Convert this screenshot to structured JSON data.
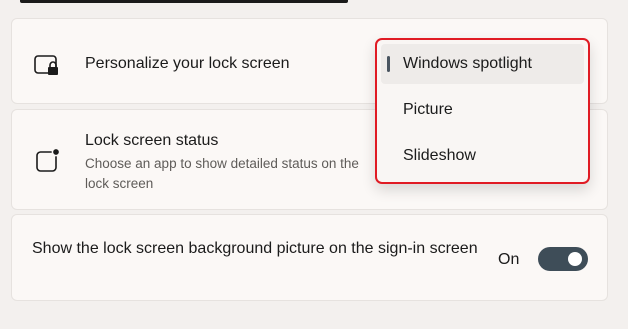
{
  "lock_screen": {
    "title": "Personalize your lock screen",
    "icon": "lock-screen-icon"
  },
  "dropdown": {
    "options": [
      "Windows spotlight",
      "Picture",
      "Slideshow"
    ],
    "selected": "Windows spotlight",
    "highlight_color": "#e01b24"
  },
  "status": {
    "title": "Lock screen status",
    "description": "Choose an app to show detailed status on the lock screen",
    "icon": "app-status-icon"
  },
  "signin": {
    "title": "Show the lock screen background picture on the sign-in screen",
    "state_label": "On",
    "toggle_on": true,
    "toggle_color": "#3e4d58"
  }
}
